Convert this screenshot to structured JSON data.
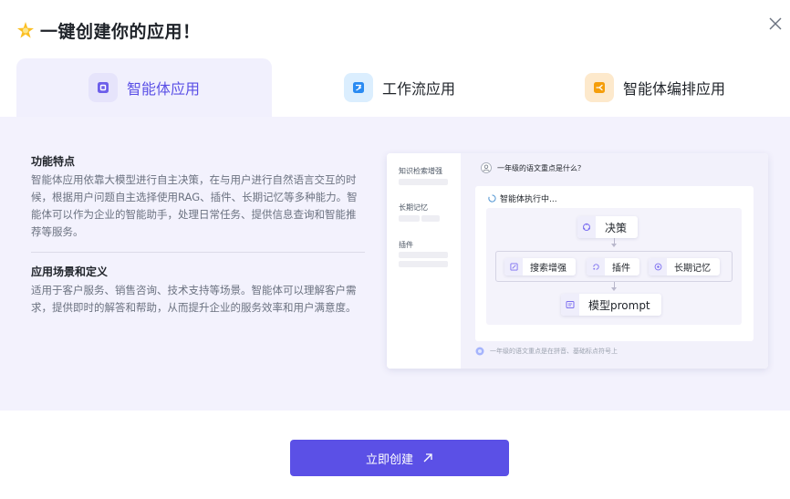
{
  "dialog": {
    "title": "一键创建你的应用！",
    "title_icon": "sparkle-icon",
    "close_icon": "close-icon"
  },
  "tabs": [
    {
      "label": "智能体应用",
      "icon": "agent-app-icon",
      "active": true,
      "icon_color": "#5b50e6"
    },
    {
      "label": "工作流应用",
      "icon": "workflow-app-icon",
      "active": false,
      "icon_color": "#2a8bf2"
    },
    {
      "label": "智能体编排应用",
      "icon": "orchestration-app-icon",
      "active": false,
      "icon_color": "#f59e0b"
    }
  ],
  "features": {
    "title": "功能特点",
    "body": "智能体应用依靠大模型进行自主决策，在与用户进行自然语言交互的时候，根据用户问题自主选择使用RAG、插件、长期记忆等多种能力。智能体可以作为企业的智能助手，处理日常任务、提供信息查询和智能推荐等服务。"
  },
  "scenarios": {
    "title": "应用场景和定义",
    "body": "适用于客户服务、销售咨询、技术支持等场景。智能体可以理解客户需求，提供即时的解答和帮助，从而提升企业的服务效率和用户满意度。"
  },
  "preview": {
    "sidebar": [
      "知识检索增强",
      "长期记忆",
      "插件"
    ],
    "question": "一年级的语文重点是什么？",
    "executing": "智能体执行中...",
    "nodes": {
      "decision": "决策",
      "search": "搜索增强",
      "plugin": "插件",
      "memory": "长期记忆",
      "prompt": "模型prompt"
    },
    "answer": "一年级的语文重点是在拼音、基础标点符号上"
  },
  "actions": {
    "create_label": "立即创建",
    "create_icon": "arrow-up-right-icon"
  },
  "colors": {
    "accent": "#5b50e6",
    "panel_bg": "#f3f2fd"
  }
}
